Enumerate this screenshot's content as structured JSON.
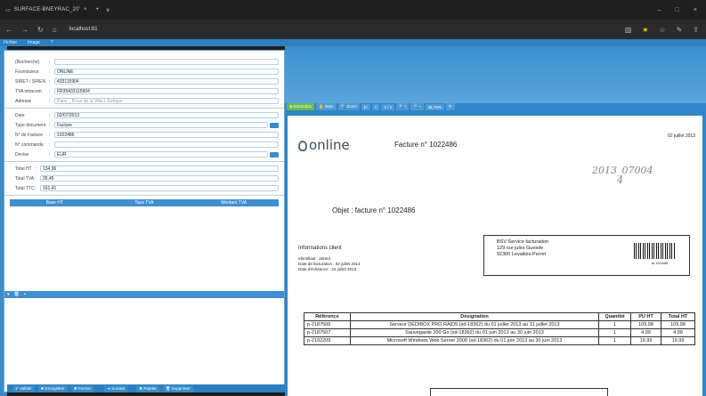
{
  "browser": {
    "tab_title": "SURFACE-BNEYRAC_20'",
    "url": "localhost:81",
    "tab_close": "×",
    "new_tab": "+",
    "tab_dropdown": "∨",
    "min": "–",
    "max": "□",
    "close": "×"
  },
  "menu": {
    "items": [
      "Fichier",
      "Image",
      "?"
    ]
  },
  "form": {
    "recherche_label": "(Recherche)",
    "recherche_value": "",
    "fournisseur_label": "Fournisseur",
    "fournisseur_value": "ONLINE",
    "siret_label": "SIRET / SIREN",
    "siret_value": "433115904",
    "tva_label": "TVA intracom.",
    "tva_value": "FR35433115904",
    "adresse_label": "Adresse",
    "adresse_placeholder": "Paris _ 8 rue de la Ville-L'Évêque",
    "date_label": "Date",
    "date_value": "02/07/2013",
    "type_label": "Type document",
    "type_value": "Facture",
    "nfacture_label": "N° de Facture",
    "nfacture_value": "1022486",
    "ncommande_label": "N° commande",
    "ncommande_value": "",
    "devise_label": "Devise",
    "devise_value": "EUR",
    "totalht_label": "Total HT",
    "totalht_value": "134,96",
    "totaltva_label": "Total TVA",
    "totaltva_value": "26,45",
    "totalttc_label": "Total TTC",
    "totalttc_value": "161,41"
  },
  "grid": {
    "headers": [
      "Base HT",
      "Taux TVA",
      "Montant TVA"
    ]
  },
  "bottom_toolbar": {
    "valider": "✔ Valider",
    "enregistrer": "✚ Enregistrer",
    "fermer": "✖ Fermer",
    "suivant": "➜ Suivant",
    "rejeter": "✖ Rejeter",
    "supprimer": "🗑 Supprimer"
  },
  "viewer_toolbar": {
    "extraction": "⊕ Extraction",
    "main": "✋ Main",
    "zoom": "🔍 Zoom",
    "page": "1 / 1",
    "zoom_level": "46,75%"
  },
  "document": {
    "logo_text": "online",
    "facture_title": "Facture n° 1022486",
    "date": "02 juillet 2013",
    "handwriting_1": "2013_07004",
    "handwriting_2": "4",
    "objet": "Objet : facture n° 1022486",
    "info_title": "Informations client",
    "info_identifiant": "Identifiant :         atirard",
    "info_facturation": "Date de facturation : 02 juillet 2013",
    "info_echeance": "Date d'échéance :   22 juillet 2013",
    "addr_line1": "BSV Service facturation",
    "addr_line2": "129 rue jules Guesde",
    "addr_line3": "92300 Levallois-Perret",
    "barcode_text": "bv 1022486",
    "table_headers": [
      "Référence",
      "Désignation",
      "Quantité",
      "PU HT",
      "Total HT"
    ],
    "rows": [
      [
        "p-2187506",
        "Serveur DEDIBOX PRO RAID5 (sd-18362) du 01 juillet 2013 au 31 juillet 2013",
        "1",
        "109,98",
        "109,98"
      ],
      [
        "p-2187507",
        "Sauvegarde 200 Go (sd-18362) du 01 juin 2013 au 30 juin 2013",
        "1",
        "4,99",
        "4,99"
      ],
      [
        "p-2192209",
        "Microsoft Windows Web Server 2008 (sd-18362) du 01 juin 2013 au 30 juin 2013",
        "1",
        "19,99",
        "19,99"
      ]
    ]
  }
}
